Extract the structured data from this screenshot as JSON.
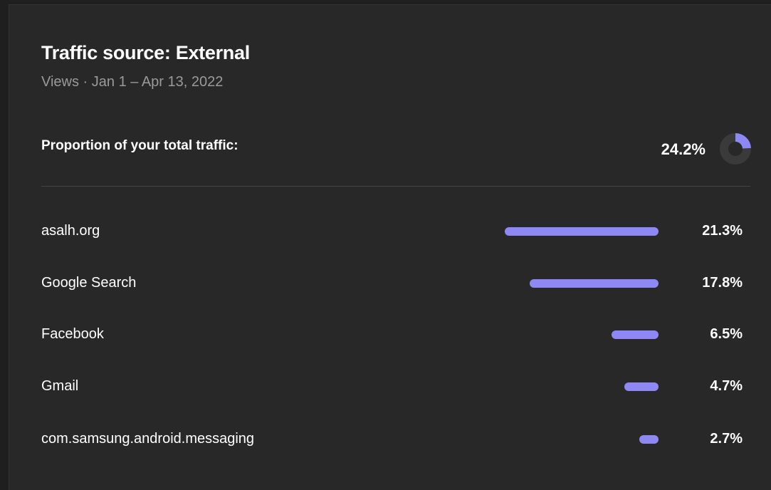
{
  "card": {
    "title": "Traffic source: External",
    "subtitle": "Views · Jan 1 – Apr 13, 2022",
    "proportion_label": "Proportion of your total traffic:",
    "proportion_value": "24.2%",
    "proportion_fraction": 0.242
  },
  "colors": {
    "accent": "#8e88f5",
    "card_bg": "#282828",
    "donut_track": "#3a3a3a"
  },
  "sources": [
    {
      "label": "asalh.org",
      "value": "21.3%",
      "percent": 21.3
    },
    {
      "label": "Google Search",
      "value": "17.8%",
      "percent": 17.8
    },
    {
      "label": "Facebook",
      "value": "6.5%",
      "percent": 6.5
    },
    {
      "label": "Gmail",
      "value": "4.7%",
      "percent": 4.7
    },
    {
      "label": "com.samsung.android.messaging",
      "value": "2.7%",
      "percent": 2.7
    }
  ]
}
